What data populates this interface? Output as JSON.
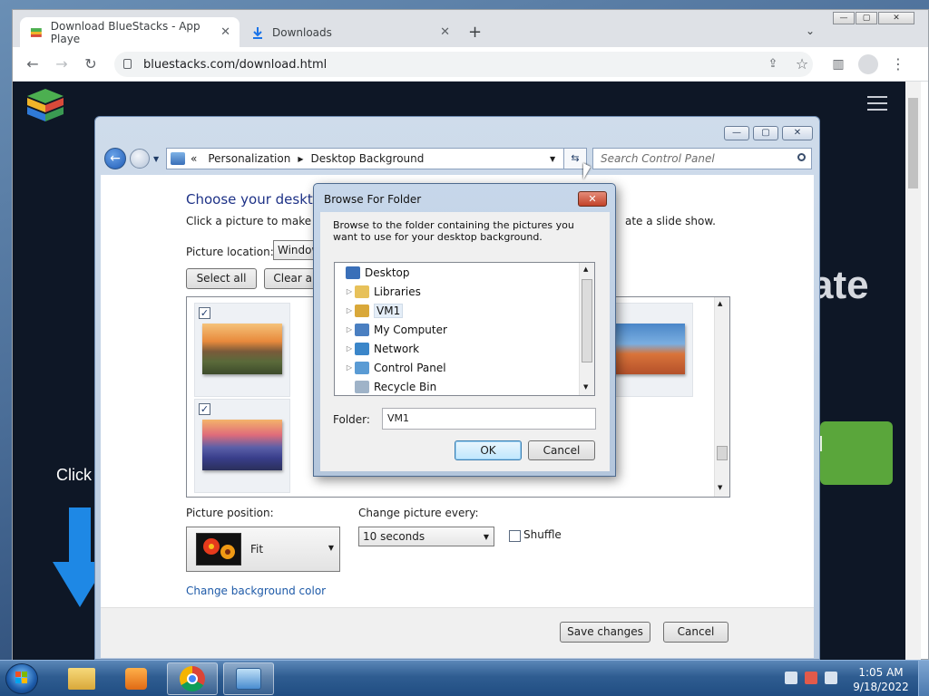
{
  "browser": {
    "tabs": [
      {
        "title": "Download BlueStacks - App Playe",
        "close": "✕"
      },
      {
        "title": "Downloads",
        "close": "✕"
      }
    ],
    "new_tab": "+",
    "url": "bluestacks.com/download.html",
    "win_controls": [
      "—",
      "▢",
      "✕"
    ]
  },
  "page": {
    "ate_text": "ate",
    "click_text": "Click",
    "green_btn_text": "d"
  },
  "control_panel": {
    "win_controls": [
      "—",
      "▢",
      "✕"
    ],
    "breadcrumb_prefix": "«",
    "breadcrumb": [
      "Personalization",
      "Desktop Background"
    ],
    "search_placeholder": "Search Control Panel",
    "heading": "Choose your desktop",
    "subtext": "Click a picture to make it y",
    "subtext_right": "ate a slide show.",
    "picture_location_label": "Picture location:",
    "picture_location_value": "Window",
    "select_all": "Select all",
    "clear_all": "Clear all",
    "picture_position_label": "Picture position:",
    "picture_position_value": "Fit",
    "change_picture_label": "Change picture every:",
    "change_picture_value": "10 seconds",
    "shuffle_label": "Shuffle",
    "change_bg_color": "Change background color",
    "save_changes": "Save changes",
    "cancel": "Cancel"
  },
  "browse_dialog": {
    "title": "Browse For Folder",
    "close": "✕",
    "description": "Browse to the folder containing the pictures you want to use for your desktop background.",
    "tree": [
      {
        "label": "Desktop",
        "icon": "desktop-icon",
        "color": "#3a6fb8"
      },
      {
        "label": "Libraries",
        "icon": "libraries-icon",
        "color": "#e7c15a"
      },
      {
        "label": "VM1",
        "icon": "user-folder-icon",
        "color": "#d9a83a"
      },
      {
        "label": "My Computer",
        "icon": "computer-icon",
        "color": "#4a7fc1"
      },
      {
        "label": "Network",
        "icon": "network-icon",
        "color": "#3b86c9"
      },
      {
        "label": "Control Panel",
        "icon": "control-panel-icon",
        "color": "#5a9bd4"
      },
      {
        "label": "Recycle Bin",
        "icon": "recycle-bin-icon",
        "color": "#9fb3c8"
      }
    ],
    "folder_label": "Folder:",
    "folder_value": "VM1",
    "ok": "OK",
    "cancel": "Cancel"
  },
  "taskbar": {
    "time": "1:05 AM",
    "date": "9/18/2022"
  }
}
